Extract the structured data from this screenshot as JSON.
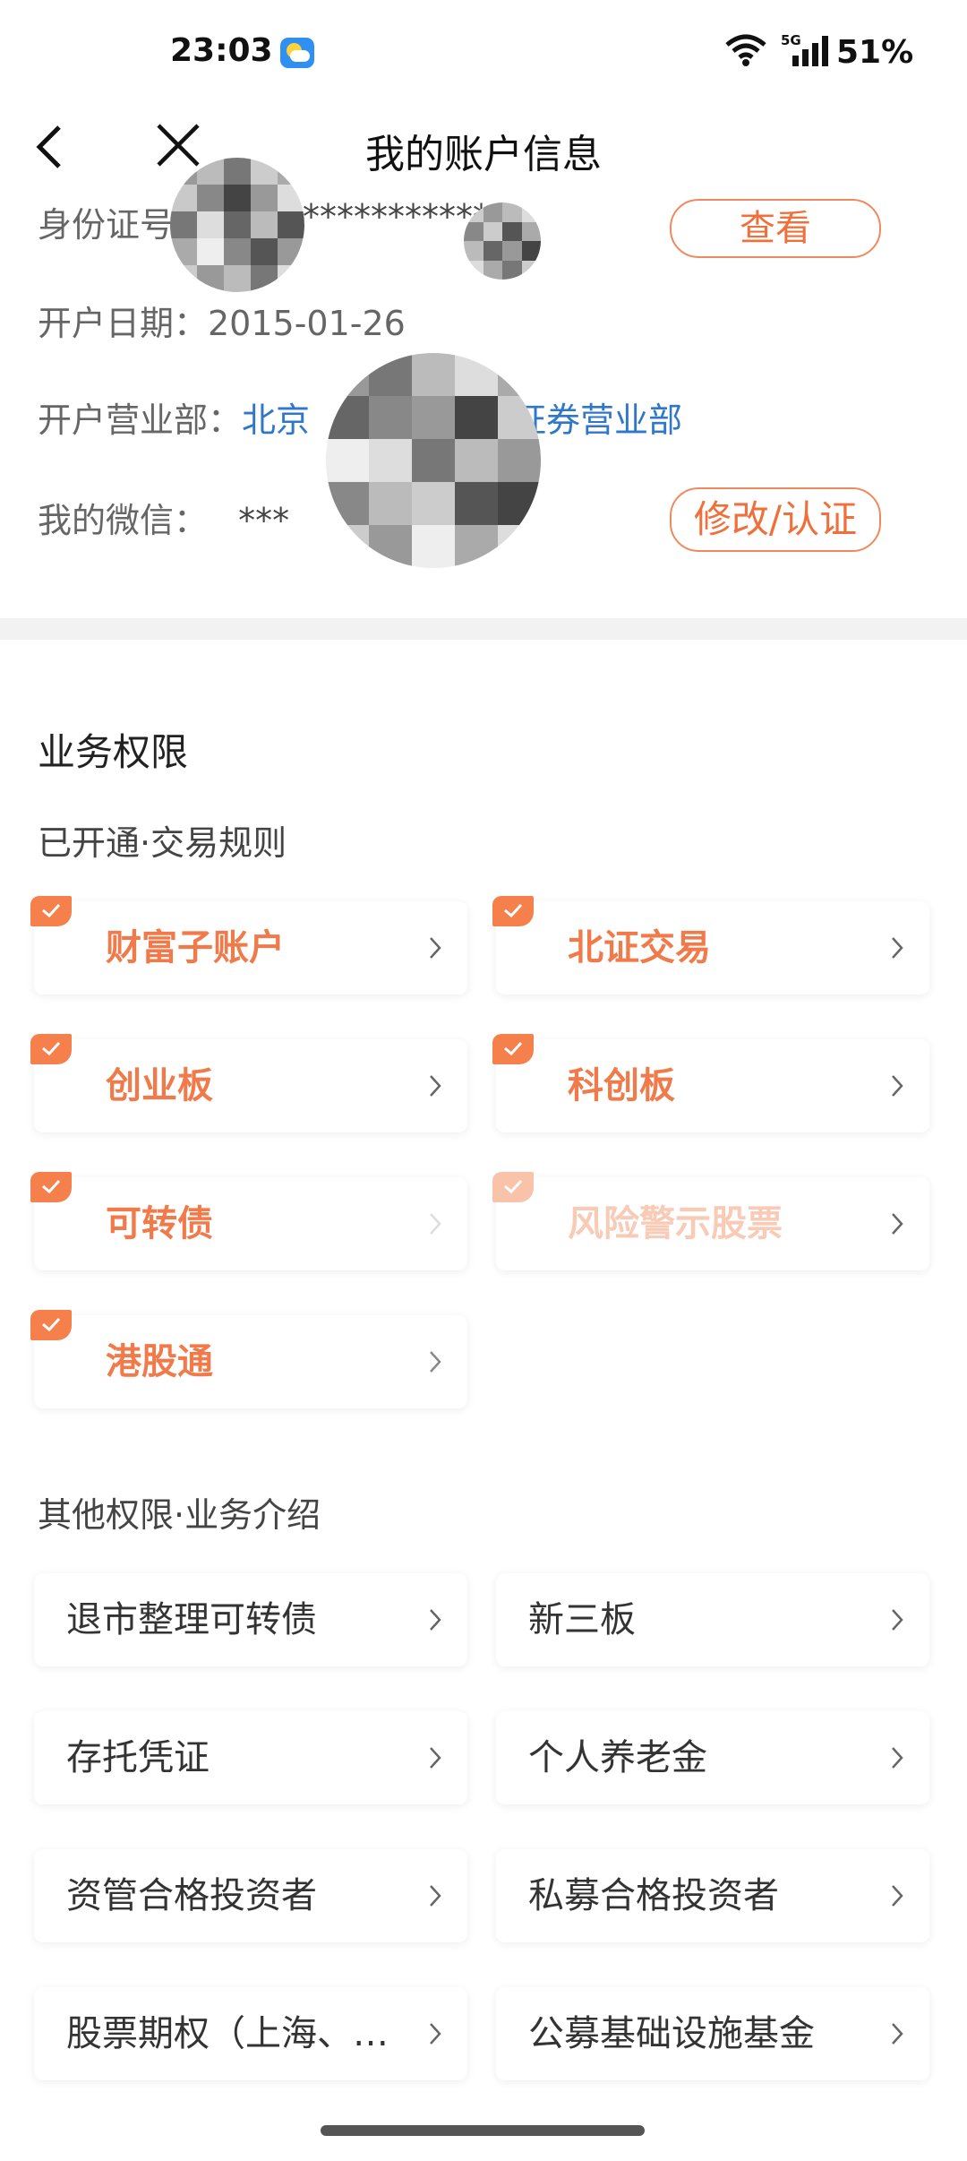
{
  "status_bar": {
    "time": "23:03",
    "network": "5G",
    "battery": "51%"
  },
  "nav": {
    "title": "我的账户信息"
  },
  "info": {
    "id_label": "身份证号",
    "id_value_partial": "***********",
    "id_button": "查看",
    "open_date": "开户日期：2015-01-26",
    "branch_label": "开户营业部：",
    "branch_part1": "北京",
    "branch_part2": "证券营业部",
    "wechat_label": "我的微信：",
    "wechat_value": "***",
    "wechat_button": "修改/认证"
  },
  "permissions": {
    "section_title": "业务权限",
    "opened_title": "已开通·交易规则",
    "opened": [
      {
        "label": "财富子账户"
      },
      {
        "label": "北证交易"
      },
      {
        "label": "创业板"
      },
      {
        "label": "科创板"
      },
      {
        "label": "可转债"
      },
      {
        "label": "风险警示股票"
      },
      {
        "label": "港股通"
      }
    ],
    "other_title": "其他权限·业务介绍",
    "other": [
      {
        "label": "退市整理可转债"
      },
      {
        "label": "新三板"
      },
      {
        "label": "存托凭证"
      },
      {
        "label": "个人养老金"
      },
      {
        "label": "资管合格投资者"
      },
      {
        "label": "私募合格投资者"
      },
      {
        "label": "股票期权（上海、…"
      },
      {
        "label": "公募基础设施基金"
      }
    ]
  },
  "colors": {
    "accent": "#f07a4a",
    "link": "#2f77c8",
    "divider": "#f2f2f2"
  }
}
